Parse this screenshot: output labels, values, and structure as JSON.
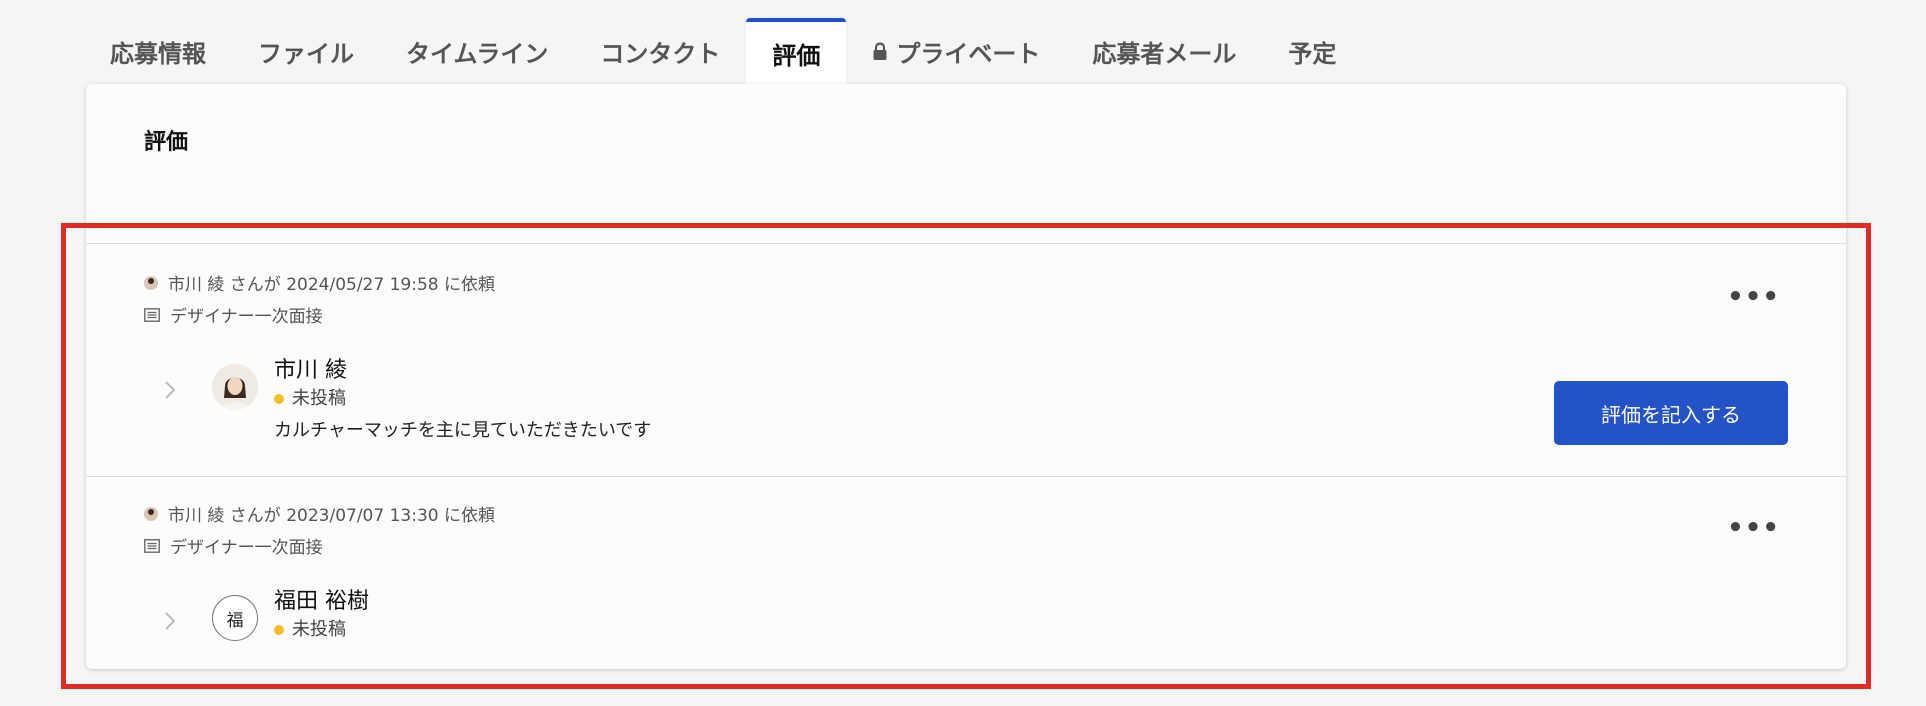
{
  "tabs": [
    {
      "label": "応募情報"
    },
    {
      "label": "ファイル"
    },
    {
      "label": "タイムライン"
    },
    {
      "label": "コンタクト"
    },
    {
      "label": "評価"
    },
    {
      "label": "プライベート"
    },
    {
      "label": "応募者メール"
    },
    {
      "label": "予定"
    }
  ],
  "active_tab": "評価",
  "card": {
    "title": "評価"
  },
  "evaluations": [
    {
      "requester": "市川 綾 さんが 2024/05/27 19:58 に依頼",
      "interview": "デザイナー一次面接",
      "evaluator_name": "市川 綾",
      "status": "未投稿",
      "comment": "カルチャーマッチを主に見ていただきたいです",
      "action_label": "評価を記入する"
    },
    {
      "requester": "市川 綾 さんが 2023/07/07 13:30 に依頼",
      "interview": "デザイナー一次面接",
      "evaluator_name": "福田 裕樹",
      "evaluator_initial": "福",
      "status": "未投稿"
    }
  ],
  "more_label": "•••",
  "colors": {
    "accent": "#2453c8",
    "status_pending": "#f3bd2c",
    "highlight": "#e12a22"
  }
}
